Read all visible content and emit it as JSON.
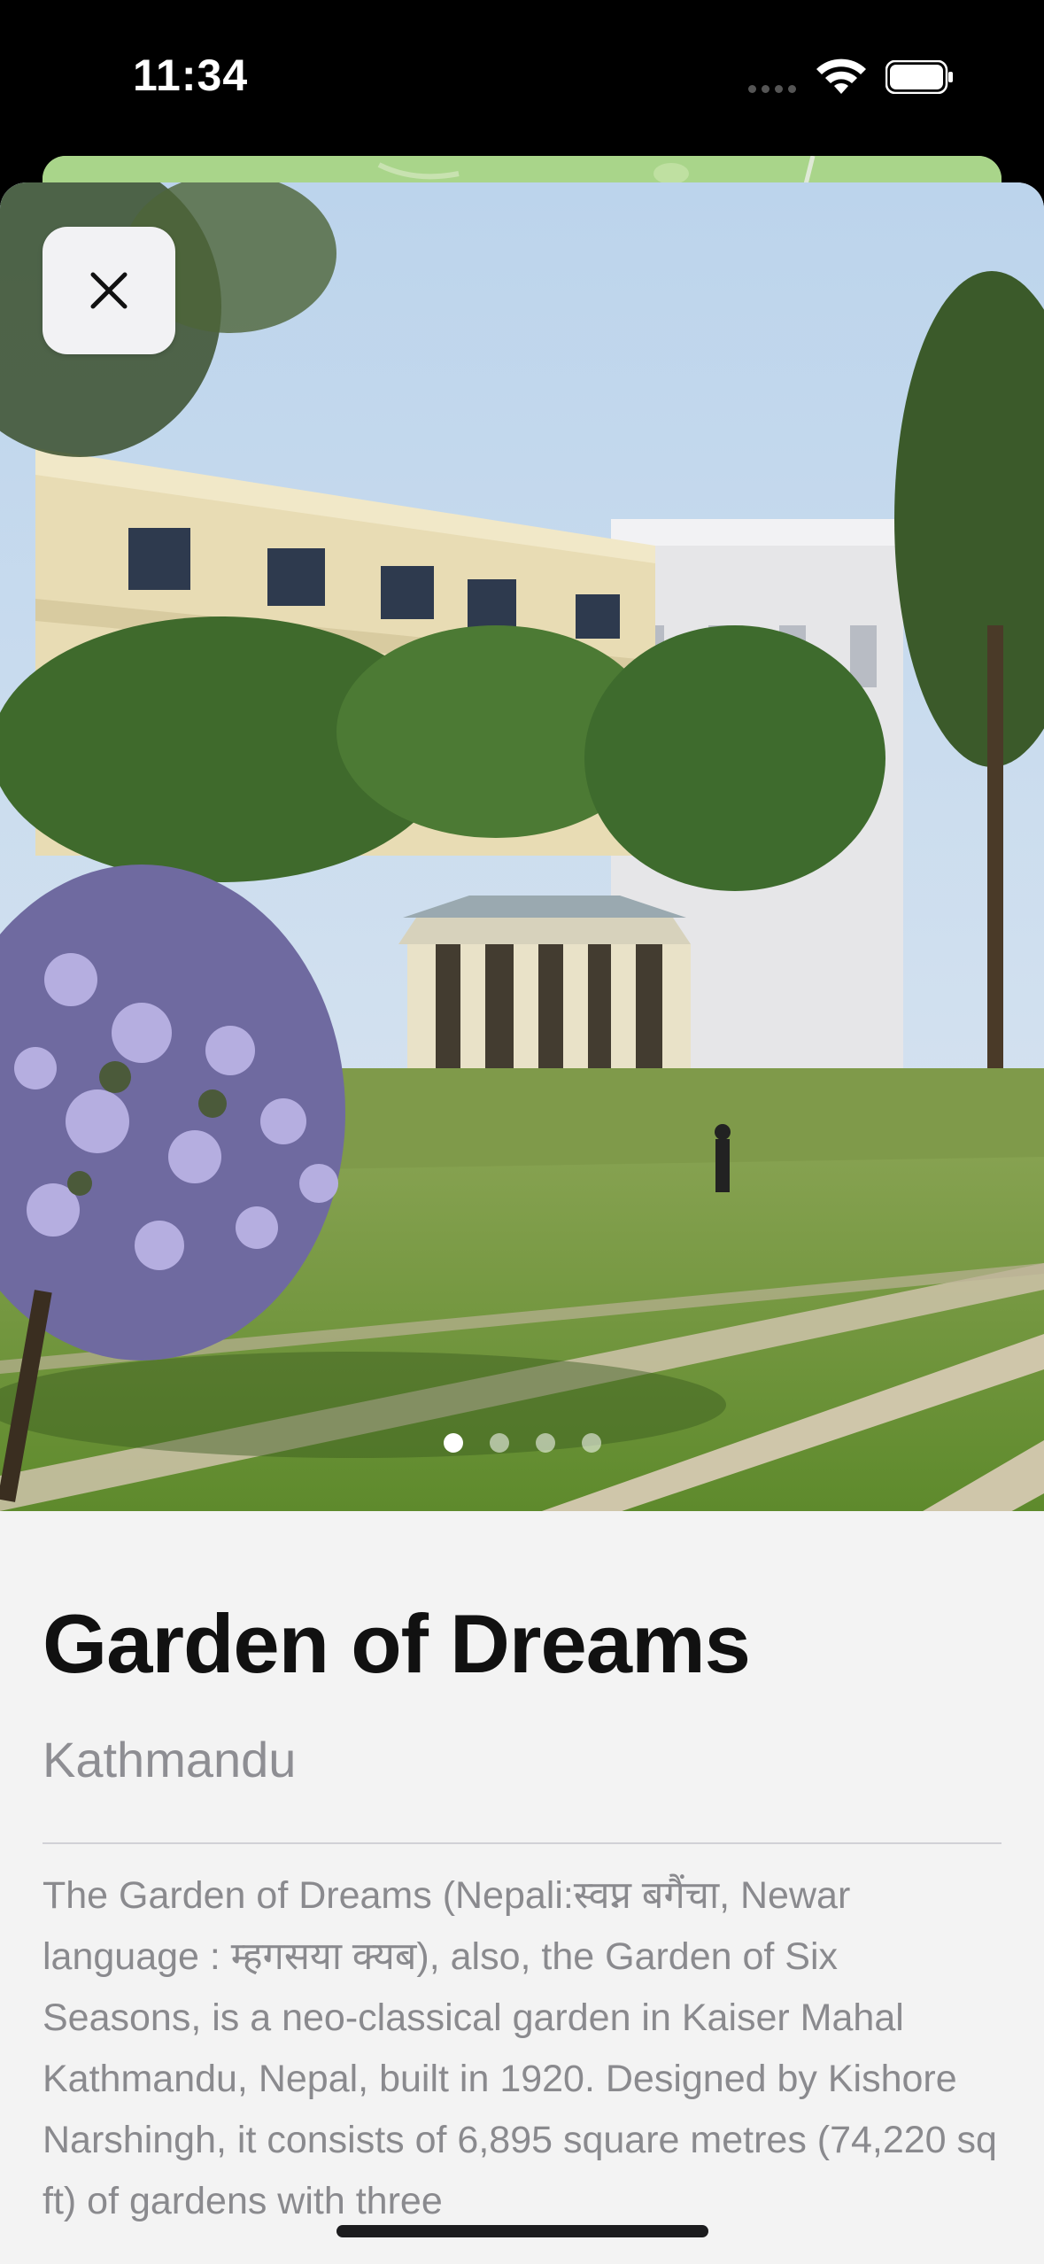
{
  "status_bar": {
    "time": "11:34"
  },
  "place": {
    "title": "Garden of Dreams",
    "location": "Kathmandu",
    "description": "The Garden of Dreams (Nepali:स्वप्न बगैंचा, Newar language : म्हगसया क्यब), also, the Garden of Six Seasons, is a neo-classical garden in Kaiser Mahal Kathmandu, Nepal, built in 1920. Designed by Kishore Narshingh, it consists of 6,895 square metres (74,220 sq ft) of gardens with three"
  },
  "gallery": {
    "page_count": 4,
    "active_index": 0
  },
  "icons": {
    "close": "close-icon",
    "wifi": "wifi-icon",
    "battery": "battery-icon",
    "signal": "cellular-signal-icon"
  },
  "colors": {
    "sheet_background": "#f3f3f3",
    "title": "#111111",
    "secondary_text": "#8e8e93"
  }
}
